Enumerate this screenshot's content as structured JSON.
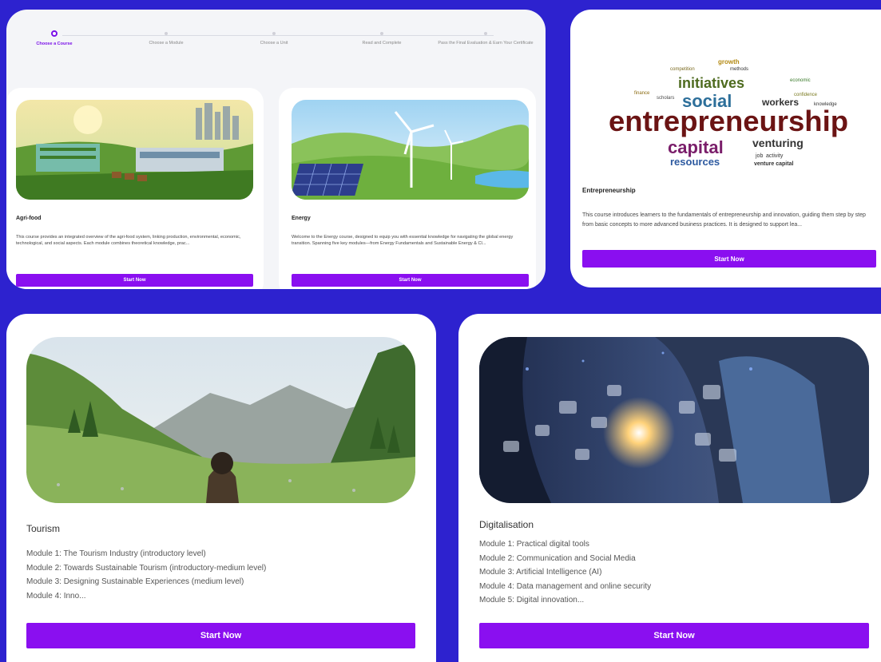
{
  "steps": [
    {
      "label": "Choose a Course",
      "active": true
    },
    {
      "label": "Choose a Module",
      "active": false
    },
    {
      "label": "Choose a Unit",
      "active": false
    },
    {
      "label": "Read and Complete",
      "active": false
    },
    {
      "label": "Pass the Final Evaluation & Earn Your Certificate",
      "active": false
    }
  ],
  "courses": {
    "agrifood": {
      "title": "Agri-food",
      "description": "This course provides an integrated overview of the agri-food system, linking production, environmental, economic, technological, and social aspects. Each module combines theoretical knowledge, prac...",
      "button": "Start Now"
    },
    "energy": {
      "title": "Energy",
      "description": "Welcome to the Energy course, designed to equip you with essential knowledge for navigating the global energy transition. Spanning five key modules—from Energy Fundamentals and Sustainable Energy & Cl...",
      "button": "Start Now"
    },
    "entrepreneurship": {
      "title": "Entrepreneurship",
      "description": "This course introduces learners to the fundamentals of entrepreneurship and innovation, guiding them step by step from basic concepts to more advanced business practices. It is designed to support lea...",
      "button": "Start Now",
      "wordcloud": [
        "entrepreneurship",
        "initiatives",
        "social",
        "capital",
        "venturing",
        "resources",
        "workers",
        "growth",
        "methods",
        "competition",
        "finance",
        "scholars",
        "knowledge",
        "venture capital",
        "activity",
        "job",
        "economic",
        "confidence"
      ]
    },
    "tourism": {
      "title": "Tourism",
      "modules": [
        "Module 1: The Tourism Industry (introductory level)",
        "Module 2: Towards Sustainable Tourism (introductory-medium level)",
        "Module 3: Designing Sustainable Experiences (medium level)",
        "Module 4: Inno..."
      ],
      "button": "Start Now"
    },
    "digitalisation": {
      "title": "Digitalisation",
      "modules": [
        "Module 1: Practical digital tools",
        "Module 2: Communication and Social Media",
        "Module 3: Artificial Intelligence (AI)",
        "Module 4: Data management and online security",
        "Module 5: Digital innovation..."
      ],
      "button": "Start Now"
    }
  },
  "colors": {
    "background": "#2d22cf",
    "accent": "#8a0ff0"
  }
}
